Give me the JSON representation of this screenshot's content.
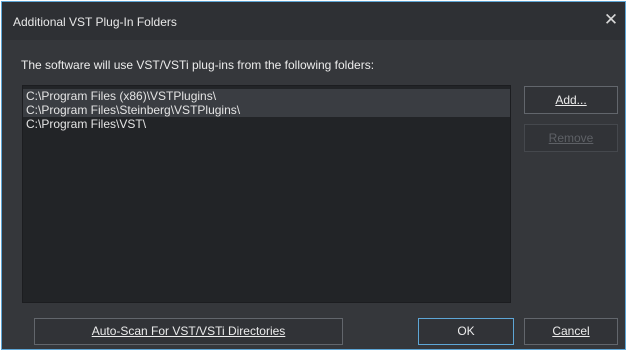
{
  "window": {
    "title": "Additional VST Plug-In Folders",
    "close_glyph": "✕",
    "close_icon": "close-icon",
    "accent_color": "#5ea6d6"
  },
  "main": {
    "prompt": "The software will use VST/VSTi plug-ins from the following folders:",
    "folders": [
      "C:\\Program Files (x86)\\VSTPlugins\\",
      "C:\\Program Files\\Steinberg\\VSTPlugins\\",
      "C:\\Program Files\\VST\\"
    ]
  },
  "buttons": {
    "add": "Add...",
    "remove": "Remove",
    "autoscan": "Auto-Scan For VST/VSTi Directories",
    "ok": "OK",
    "cancel": "Cancel"
  }
}
